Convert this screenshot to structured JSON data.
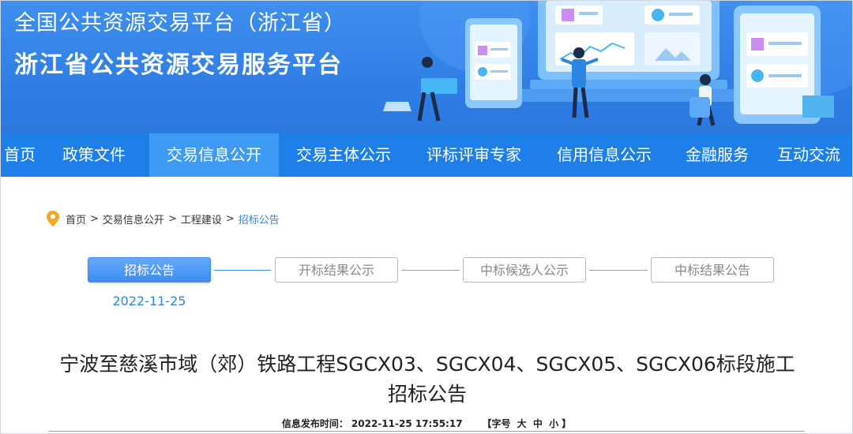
{
  "header": {
    "title_line1": "全国公共资源交易平台（浙江省）",
    "title_line2": "浙江省公共资源交易服务平台"
  },
  "nav": {
    "items": [
      {
        "label": "首页"
      },
      {
        "label": "政策文件"
      },
      {
        "label": "交易信息公开",
        "active": true
      },
      {
        "label": "交易主体公示"
      },
      {
        "label": "评标评审专家"
      },
      {
        "label": "信用信息公示"
      },
      {
        "label": "金融服务"
      },
      {
        "label": "互动交流"
      }
    ]
  },
  "breadcrumb": {
    "items": [
      "首页",
      "交易信息公开",
      "工程建设",
      "招标公告"
    ],
    "separator": ">"
  },
  "steps": {
    "items": [
      "招标公告",
      "开标结果公示",
      "中标候选人公示",
      "中标结果公告"
    ],
    "active_index": 0,
    "active_date": "2022-11-25"
  },
  "article": {
    "title_line1": "宁波至慈溪市域（郊）铁路工程SGCX03、SGCX04、SGCX05、SGCX06标段施工",
    "title_line2": "招标公告",
    "publish_label": "信息发布时间：",
    "publish_time": "2022-11-25 17:55:17",
    "font_size_open": "【字号",
    "font_size_large": "大",
    "font_size_medium": "中",
    "font_size_small": "小",
    "font_size_close": "】"
  },
  "colors": {
    "banner": "#2f7fe6",
    "nav": "#1f7fe9",
    "nav_active": "#3d9bf4",
    "accent": "#2e86de",
    "pin": "#f5a623"
  }
}
